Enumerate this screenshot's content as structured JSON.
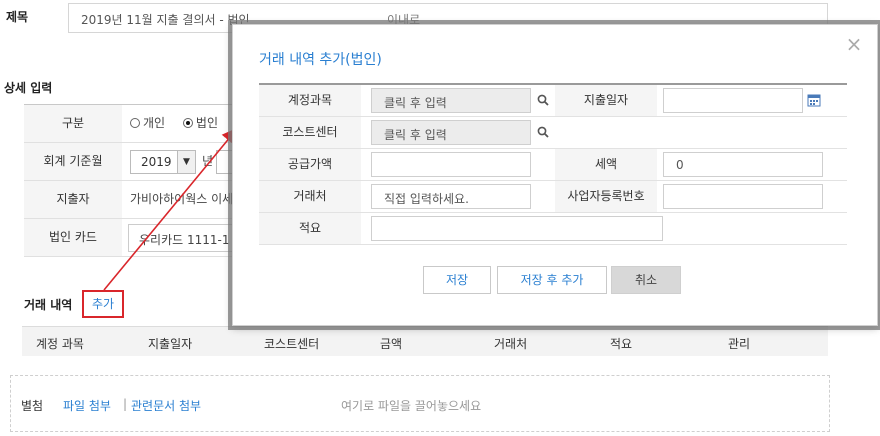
{
  "form": {
    "title_label": "제목",
    "title_value": "2019년 11월 지출 결의서 - 법인",
    "title_clip": "이내로",
    "detail_label": "상세 입력",
    "rows": [
      {
        "label": "구분"
      },
      {
        "label": "회계 기준월"
      },
      {
        "label": "지출자",
        "value": "가비아하이웍스 이세"
      },
      {
        "label": "법인 카드",
        "value": "우리카드 1111-1"
      }
    ],
    "type_options": [
      "개인",
      "법인"
    ],
    "year_value": "2019",
    "year_suffix": "년",
    "trade_title": "거래 내역",
    "add_label": "추가",
    "columns": [
      "계정 과목",
      "지출일자",
      "코스트센터",
      "금액",
      "거래처",
      "적요",
      "관리"
    ],
    "attach": {
      "label": "별첨",
      "file_link": "파일 첨부",
      "separator": "|",
      "doc_link": "관련문서 첨부",
      "hint": "여기로 파일을 끌어놓으세요"
    }
  },
  "modal": {
    "title": "거래 내역 추가(법인)",
    "close": "×",
    "labels": {
      "account": "계정과목",
      "date": "지출일자",
      "cost_center": "코스트센터",
      "supply": "공급가액",
      "tax": "세액",
      "vendor": "거래처",
      "biz_no": "사업자등록번호",
      "memo": "적요"
    },
    "placeholders": {
      "account": "클릭 후 입력",
      "cost_center": "클릭 후 입력",
      "vendor": "직접 입력하세요."
    },
    "values": {
      "tax": "0"
    },
    "buttons": {
      "save": "저장",
      "save_add": "저장 후 추가",
      "cancel": "취소"
    }
  },
  "colors": {
    "accent": "#2a7fd1",
    "highlight": "#d9262b"
  },
  "icons": [
    "search-icon",
    "calendar-icon",
    "close-icon",
    "chevron-down-icon",
    "radio-icon"
  ]
}
